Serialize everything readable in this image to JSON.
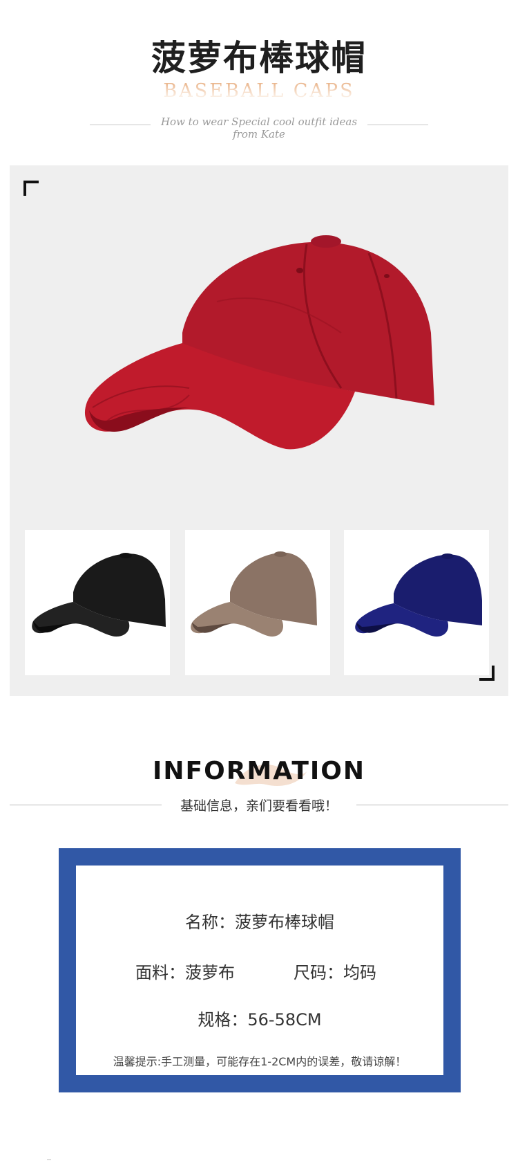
{
  "header": {
    "title_cn": "菠萝布棒球帽",
    "title_en": "BASEBALL CAPS",
    "tagline": "How to wear Special cool outfit ideas from Kate"
  },
  "product": {
    "main_image": {
      "name": "red-baseball-cap",
      "color": "#b5182a"
    },
    "variants": [
      {
        "name": "black-baseball-cap",
        "color": "#1b1b1b"
      },
      {
        "name": "khaki-baseball-cap",
        "color": "#8c7566"
      },
      {
        "name": "navy-baseball-cap",
        "color": "#1a1d6e"
      }
    ]
  },
  "information": {
    "title": "INFORMATION",
    "subtitle": "基础信息，亲们要看看哦！",
    "name_line": "名称：菠萝布棒球帽",
    "material_line": "面料：菠萝布",
    "size_line": "尺码：均码",
    "spec_line": "规格：56-58CM",
    "tip_line": "温馨提示:手工测量，可能存在1-2CM内的误差，敬请谅解！"
  },
  "colors": {
    "frame": "#3158a6",
    "panel_bg": "#efefef",
    "title_en_accent": "#edc6a4"
  }
}
